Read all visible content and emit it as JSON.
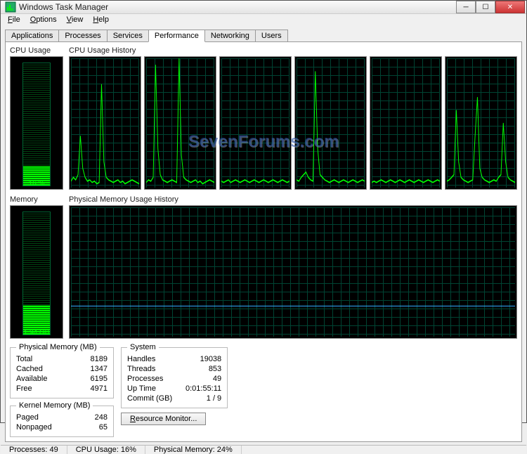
{
  "window": {
    "title": "Windows Task Manager"
  },
  "menu": {
    "file": "File",
    "options": "Options",
    "view": "View",
    "help": "Help"
  },
  "tabs": {
    "applications": "Applications",
    "processes": "Processes",
    "services": "Services",
    "performance": "Performance",
    "networking": "Networking",
    "users": "Users"
  },
  "labels": {
    "cpu_usage": "CPU Usage",
    "cpu_history": "CPU Usage History",
    "memory": "Memory",
    "mem_history": "Physical Memory Usage History"
  },
  "gauges": {
    "cpu_text": "16 %",
    "cpu_fill_pct": 16,
    "mem_text": "1.94 GB",
    "mem_fill_pct": 24
  },
  "watermark": "SevenForums.com",
  "phys_mem": {
    "legend": "Physical Memory (MB)",
    "total_k": "Total",
    "total_v": "8189",
    "cached_k": "Cached",
    "cached_v": "1347",
    "available_k": "Available",
    "available_v": "6195",
    "free_k": "Free",
    "free_v": "4971"
  },
  "kernel_mem": {
    "legend": "Kernel Memory (MB)",
    "paged_k": "Paged",
    "paged_v": "248",
    "nonpaged_k": "Nonpaged",
    "nonpaged_v": "65"
  },
  "system": {
    "legend": "System",
    "handles_k": "Handles",
    "handles_v": "19038",
    "threads_k": "Threads",
    "threads_v": "853",
    "processes_k": "Processes",
    "processes_v": "49",
    "uptime_k": "Up Time",
    "uptime_v": "0:01:55:11",
    "commit_k": "Commit (GB)",
    "commit_v": "1 / 9"
  },
  "buttons": {
    "resource_monitor": "Resource Monitor..."
  },
  "status": {
    "processes": "Processes: 49",
    "cpu": "CPU Usage: 16%",
    "mem": "Physical Memory: 24%"
  },
  "chart_data": {
    "cpu_cores": [
      {
        "type": "line",
        "values": [
          5,
          8,
          6,
          10,
          40,
          15,
          8,
          5,
          6,
          4,
          5,
          3,
          4,
          80,
          20,
          8,
          6,
          5,
          4,
          5,
          6,
          4,
          5,
          3,
          4,
          5,
          6,
          5,
          4,
          3
        ]
      },
      {
        "type": "line",
        "values": [
          4,
          6,
          5,
          8,
          95,
          30,
          10,
          6,
          5,
          4,
          5,
          6,
          5,
          4,
          100,
          25,
          8,
          6,
          5,
          4,
          5,
          6,
          4,
          5,
          3,
          4,
          5,
          6,
          5,
          4
        ]
      },
      {
        "type": "line",
        "values": [
          5,
          4,
          5,
          6,
          4,
          5,
          6,
          5,
          4,
          5,
          6,
          5,
          4,
          5,
          6,
          5,
          4,
          5,
          6,
          5,
          4,
          5,
          6,
          5,
          4,
          5,
          6,
          5,
          4,
          5
        ]
      },
      {
        "type": "line",
        "values": [
          6,
          5,
          8,
          10,
          12,
          8,
          6,
          5,
          90,
          30,
          10,
          8,
          6,
          5,
          4,
          5,
          6,
          5,
          4,
          5,
          6,
          5,
          4,
          5,
          6,
          5,
          4,
          5,
          6,
          5
        ]
      },
      {
        "type": "line",
        "values": [
          4,
          5,
          4,
          5,
          6,
          5,
          4,
          5,
          6,
          5,
          4,
          5,
          6,
          5,
          4,
          5,
          6,
          5,
          4,
          5,
          6,
          5,
          4,
          5,
          6,
          5,
          4,
          5,
          6,
          5
        ]
      },
      {
        "type": "line",
        "values": [
          5,
          6,
          8,
          10,
          60,
          20,
          8,
          6,
          5,
          4,
          5,
          6,
          40,
          70,
          15,
          8,
          6,
          5,
          4,
          5,
          6,
          5,
          8,
          10,
          50,
          20,
          8,
          6,
          5,
          4
        ]
      }
    ],
    "memory_history": {
      "type": "line",
      "pct": 24
    }
  }
}
